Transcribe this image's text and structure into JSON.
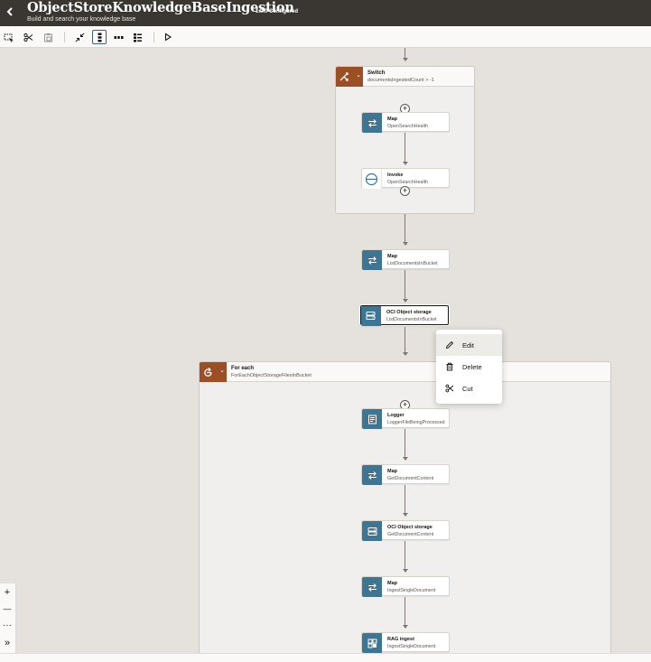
{
  "header": {
    "back_icon": "chevron-left-icon",
    "title": "ObjectStoreKnowledgeBaseIngestion",
    "subtitle": "Build and search your knowledge base",
    "version_status": "1.0.0 Configured"
  },
  "toolbar": {
    "items": [
      {
        "name": "select-icon",
        "active": false
      },
      {
        "name": "cut-icon",
        "active": false
      },
      {
        "name": "paste-icon",
        "active": false
      },
      {
        "name": "collapse-icon",
        "active": false
      },
      {
        "name": "vertical-layout-icon",
        "active": true
      },
      {
        "name": "horizontal-layout-icon",
        "active": false
      },
      {
        "name": "list-layout-icon",
        "active": false
      },
      {
        "name": "play-icon",
        "active": false
      }
    ]
  },
  "flow": {
    "switch": {
      "title": "Switch",
      "condition": "documentsIngestedCount > -1",
      "map": {
        "title": "Map",
        "subtitle": "OpenSearchHealth"
      },
      "invoke": {
        "title": "Invoke",
        "subtitle": "OpenSearchHealth"
      }
    },
    "map_list": {
      "title": "Map",
      "subtitle": "ListDocumentsInBucket"
    },
    "oci_list": {
      "title": "OCI Object storage",
      "subtitle": "ListDocumentsInBucket"
    },
    "for_each": {
      "title": "For each",
      "subtitle": "ForEachObjectStorageFilesInBucket",
      "logger": {
        "title": "Logger",
        "subtitle": "LoggerFileBeingProcessed"
      },
      "map_get": {
        "title": "Map",
        "subtitle": "GetDocumentContent"
      },
      "oci_get": {
        "title": "OCI Object storage",
        "subtitle": "GetDocumentContent"
      },
      "map_ingest": {
        "title": "Map",
        "subtitle": "IngestSingleDocument"
      },
      "rag": {
        "title": "RAG ingest",
        "subtitle": "IngestSingleDocument"
      }
    }
  },
  "context_menu": {
    "items": [
      {
        "label": "Edit",
        "icon": "pencil-icon"
      },
      {
        "label": "Delete",
        "icon": "trash-icon"
      },
      {
        "label": "Cut",
        "icon": "scissors-icon"
      }
    ]
  },
  "zoom": {
    "zoom_in": "+",
    "zoom_out": "—",
    "more": "···",
    "expand": "»"
  },
  "colors": {
    "header_bg": "#3a3632",
    "canvas_bg": "#e5e2dd",
    "action_tile": "#3d7593",
    "container_tile": "#9c4f25"
  }
}
